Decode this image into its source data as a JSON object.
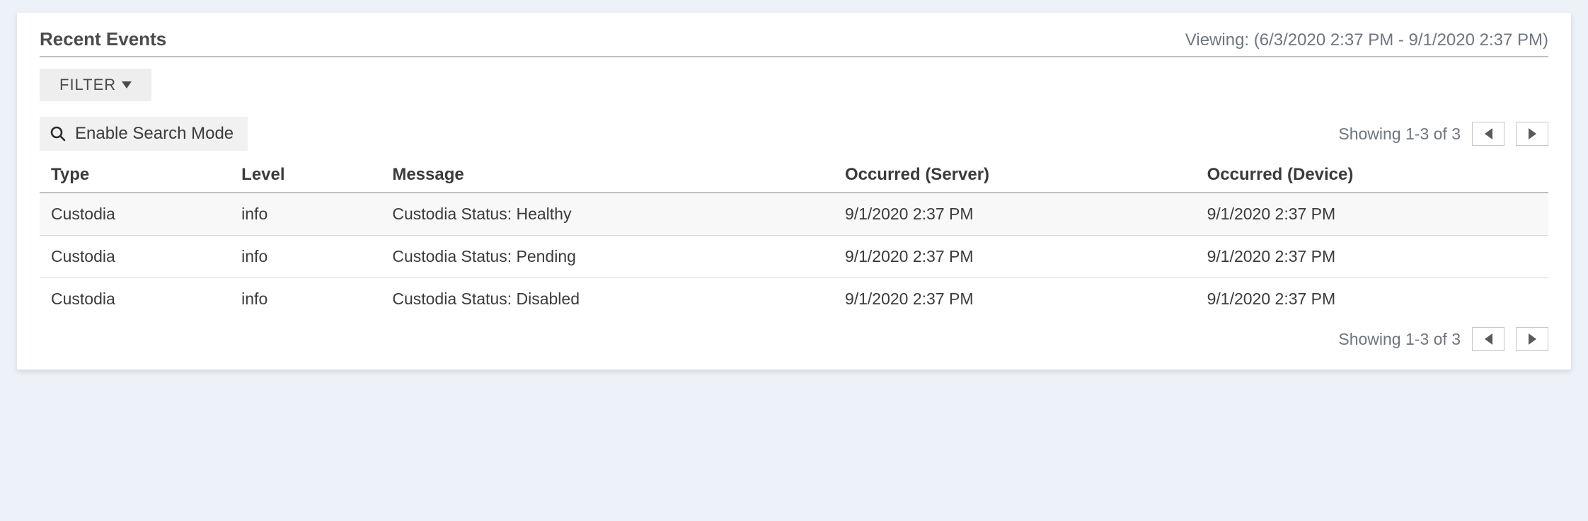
{
  "header": {
    "title": "Recent Events",
    "viewing_label": "Viewing: (6/3/2020 2:37 PM - 9/1/2020 2:37 PM)"
  },
  "toolbar": {
    "filter_label": "FILTER"
  },
  "search": {
    "toggle_label": "Enable Search Mode"
  },
  "pager": {
    "summary": "Showing 1-3 of 3"
  },
  "table": {
    "columns": {
      "type": "Type",
      "level": "Level",
      "message": "Message",
      "occurred_server": "Occurred (Server)",
      "occurred_device": "Occurred (Device)"
    },
    "rows": [
      {
        "type": "Custodia",
        "level": "info",
        "message": "Custodia Status: Healthy",
        "occurred_server": "9/1/2020 2:37 PM",
        "occurred_device": "9/1/2020 2:37 PM"
      },
      {
        "type": "Custodia",
        "level": "info",
        "message": "Custodia Status: Pending",
        "occurred_server": "9/1/2020 2:37 PM",
        "occurred_device": "9/1/2020 2:37 PM"
      },
      {
        "type": "Custodia",
        "level": "info",
        "message": "Custodia Status: Disabled",
        "occurred_server": "9/1/2020 2:37 PM",
        "occurred_device": "9/1/2020 2:37 PM"
      }
    ]
  }
}
